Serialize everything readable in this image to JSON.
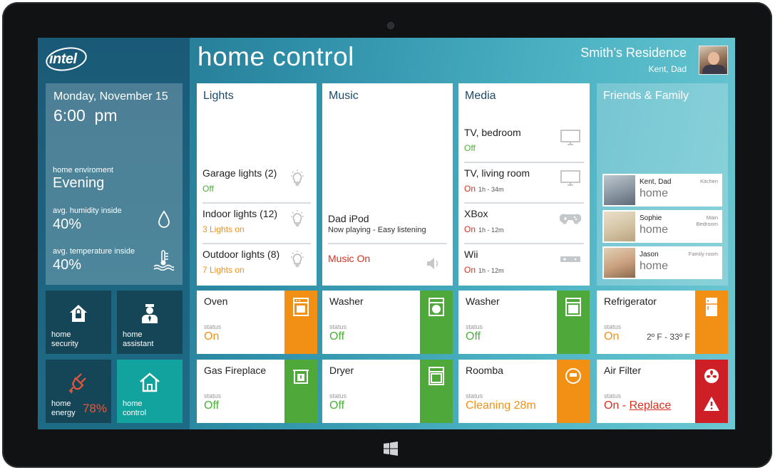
{
  "brand": {
    "logo_text": "intel"
  },
  "header": {
    "title": "home control",
    "residence": "Smith’s Residence",
    "user": "Kent, Dad"
  },
  "sidebar": {
    "date": "Monday, November 15",
    "time": "6:00  pm",
    "environment_label": "home enviroment",
    "environment_value": "Evening",
    "humidity_label": "avg. humidity inside",
    "humidity_value": "40%",
    "temperature_label": "avg. temperature inside",
    "temperature_value": "40%",
    "tiles": {
      "security": "home\nsecurity",
      "assistant": "home\nassistant",
      "energy": "home\nenergy",
      "energy_value": "78%",
      "control": "home\ncontrol"
    }
  },
  "lights": {
    "title": "Lights",
    "items": [
      {
        "name": "Garage lights (2)",
        "status": "Off"
      },
      {
        "name": "Indoor lights (12)",
        "status": "3 Lights on"
      },
      {
        "name": "Outdoor lights (8)",
        "status": "7 Lights on"
      }
    ]
  },
  "music": {
    "title": "Music",
    "device": "Dad iPod",
    "now_playing": "Now playing - Easy listening",
    "status": "Music On"
  },
  "media": {
    "title": "Media",
    "items": [
      {
        "name": "TV, bedroom",
        "status": "Off",
        "duration": ""
      },
      {
        "name": "TV, living room",
        "status": "On",
        "duration": "1h - 34m"
      },
      {
        "name": "XBox",
        "status": "On",
        "duration": "1h - 12m"
      },
      {
        "name": "Wii",
        "status": "On",
        "duration": "1h - 12m"
      }
    ]
  },
  "friends": {
    "title": "Friends & Family",
    "people": [
      {
        "name": "Kent, Dad",
        "status": "home",
        "room": "Kitchen"
      },
      {
        "name": "Sophie",
        "status": "home",
        "room": "Main\nBedroom"
      },
      {
        "name": "Jason",
        "status": "home",
        "room": "Family room"
      }
    ]
  },
  "devices": {
    "status_label": "status",
    "oven": {
      "name": "Oven",
      "status": "On"
    },
    "washer1": {
      "name": "Washer",
      "status": "Off"
    },
    "washer2": {
      "name": "Washer",
      "status": "Off"
    },
    "refrigerator": {
      "name": "Refrigerator",
      "status": "On",
      "range": "2º F - 33º F"
    },
    "fireplace": {
      "name": "Gas Fireplace",
      "status": "Off"
    },
    "dryer": {
      "name": "Dryer",
      "status": "Off"
    },
    "roomba": {
      "name": "Roomba",
      "status": "Cleaning 28m"
    },
    "airfilter": {
      "name": "Air Filter",
      "status": "On",
      "dash": " - ",
      "action": "Replace"
    }
  },
  "colors": {
    "green": "#4ea83a",
    "orange": "#f28f15",
    "red": "#cf1f26",
    "teal": "#13a39e",
    "dark_tile": "#154657"
  },
  "icons": [
    "drop-icon",
    "thermometer-icon",
    "lock-house-icon",
    "butler-icon",
    "plug-icon",
    "house-icon",
    "bulb-icon",
    "speaker-icon",
    "tv-icon",
    "gamepad-icon",
    "console-icon",
    "oven-icon",
    "washer-icon",
    "fridge-icon",
    "fireplace-icon",
    "dryer-icon",
    "roomba-icon",
    "fan-icon",
    "warning-icon",
    "windows-icon"
  ]
}
